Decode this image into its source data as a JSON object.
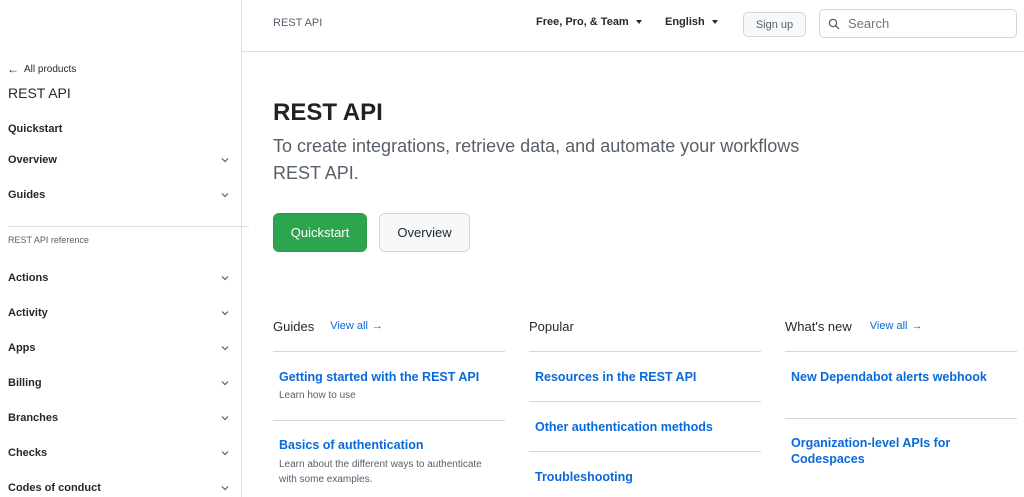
{
  "sidebar": {
    "back_label": "All products",
    "product_title": "REST API",
    "items_top": [
      {
        "label": "Quickstart",
        "has_chevron": false
      },
      {
        "label": "Overview",
        "has_chevron": true
      },
      {
        "label": "Guides",
        "has_chevron": true
      }
    ],
    "section_label": "REST API reference",
    "items_ref": [
      {
        "label": "Actions"
      },
      {
        "label": "Activity"
      },
      {
        "label": "Apps"
      },
      {
        "label": "Billing"
      },
      {
        "label": "Branches"
      },
      {
        "label": "Checks"
      },
      {
        "label": "Codes of conduct"
      }
    ]
  },
  "header": {
    "breadcrumb": "REST API",
    "plan_dropdown": "Free, Pro, & Team",
    "language_dropdown": "English",
    "signup_label": "Sign up",
    "search_placeholder": "Search"
  },
  "main": {
    "title": "REST API",
    "intro": "To create integrations, retrieve data, and automate your workflows REST API.",
    "primary_button": "Quickstart",
    "secondary_button": "Overview",
    "columns": {
      "guides": {
        "heading": "Guides",
        "view_all": "View all",
        "cards": [
          {
            "title": "Getting started with the REST API",
            "desc": "Learn how to use"
          },
          {
            "title": "Basics of authentication",
            "desc": "Learn about the different ways to authenticate with some examples."
          }
        ]
      },
      "popular": {
        "heading": "Popular",
        "cards": [
          {
            "title": "Resources in the REST API"
          },
          {
            "title": "Other authentication methods"
          },
          {
            "title": "Troubleshooting"
          }
        ]
      },
      "whats_new": {
        "heading": "What's new",
        "view_all": "View all",
        "cards": [
          {
            "title": "New Dependabot alerts webhook"
          },
          {
            "title": "Organization-level APIs for Codespaces"
          }
        ]
      }
    }
  },
  "colors": {
    "primary_green": "#2da44e",
    "link_blue": "#0969da",
    "muted_text": "#57606a",
    "border": "#d0d7de"
  }
}
